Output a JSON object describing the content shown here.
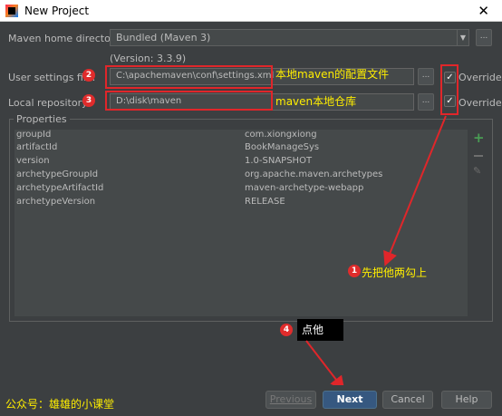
{
  "window": {
    "title": "New Project",
    "close": "✕"
  },
  "maven_home": {
    "label": "Maven home directory:",
    "value": "Bundled (Maven 3)",
    "version": "(Version: 3.3.9)"
  },
  "user_settings": {
    "label": "User settings file:",
    "value": "C:\\apachemaven\\conf\\settings.xml",
    "override_label": "Override",
    "override_checked": true
  },
  "local_repo": {
    "label": "Local repository:",
    "value": "D:\\disk\\maven",
    "override_label": "Override",
    "override_checked": true
  },
  "properties": {
    "title": "Properties",
    "rows": [
      {
        "key": "groupId",
        "value": "com.xiongxiong"
      },
      {
        "key": "artifactId",
        "value": "BookManageSys"
      },
      {
        "key": "version",
        "value": "1.0-SNAPSHOT"
      },
      {
        "key": "archetypeGroupId",
        "value": "org.apache.maven.archetypes"
      },
      {
        "key": "archetypeArtifactId",
        "value": "maven-archetype-webapp"
      },
      {
        "key": "archetypeVersion",
        "value": "RELEASE"
      }
    ]
  },
  "annotations": {
    "badge2": "2",
    "badge3": "3",
    "badge1": "1",
    "badge4": "4",
    "settings_note": "本地maven的配置文件",
    "repo_note": "maven本地仓库",
    "check_note": "先把他两勾上",
    "click_note": "点他",
    "watermark": "公众号：雄雄的小课堂"
  },
  "buttons": {
    "previous": "Previous",
    "next": "Next",
    "cancel": "Cancel",
    "help": "Help"
  },
  "colors": {
    "background": "#3c3f41",
    "highlight_red": "#e0262a",
    "note_yellow": "#ffee00",
    "primary_button": "#365880"
  }
}
